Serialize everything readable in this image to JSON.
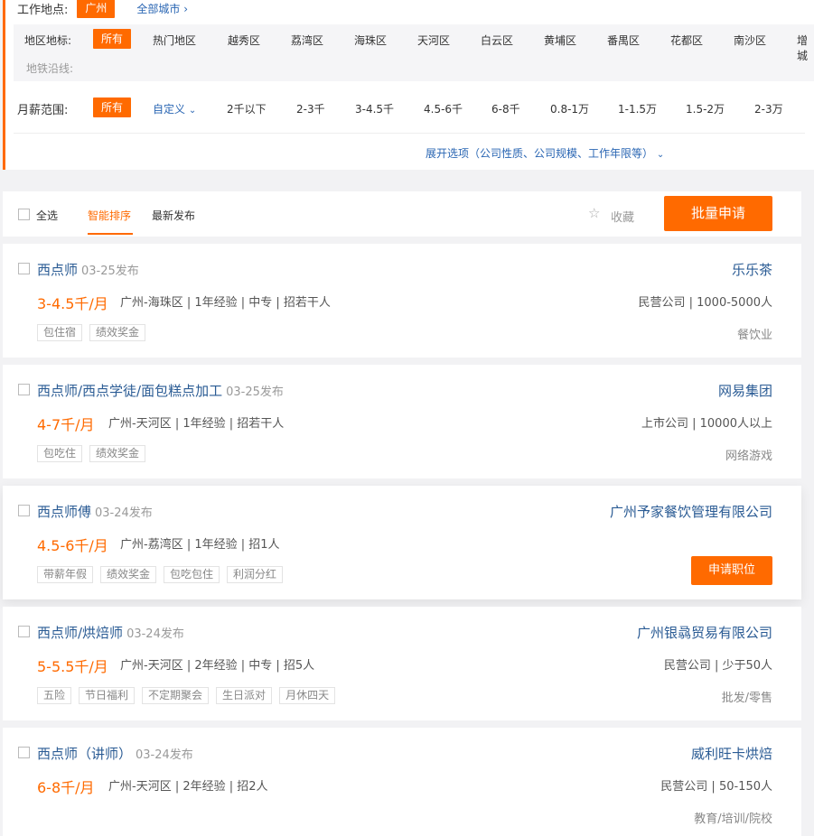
{
  "filters": {
    "location_label": "工作地点:",
    "location_active": "广州",
    "all_cities": "全部城市",
    "district_label": "地区地标:",
    "district_active": "所有",
    "districts": [
      "热门地区",
      "越秀区",
      "荔湾区",
      "海珠区",
      "天河区",
      "白云区",
      "黄埔区",
      "番禺区",
      "花都区",
      "南沙区",
      "增城"
    ],
    "metro_label": "地铁沿线:",
    "salary_label": "月薪范围:",
    "salary_active": "所有",
    "salary_custom": "自定义",
    "salaries": [
      "2千以下",
      "2-3千",
      "3-4.5千",
      "4.5-6千",
      "6-8千",
      "0.8-1万",
      "1-1.5万",
      "1.5-2万",
      "2-3万"
    ],
    "expand": "展开选项（公司性质、公司规模、工作年限等）"
  },
  "sortbar": {
    "select_all": "全选",
    "smart_sort": "智能排序",
    "latest": "最新发布",
    "favorite": "收藏",
    "batch_apply": "批量申请"
  },
  "jobs": [
    {
      "title": "西点师",
      "date": "03-25发布",
      "salary": "3-4.5千/月",
      "meta": "广州-海珠区 | 1年经验 | 中专 | 招若干人",
      "tags": [
        "包住宿",
        "绩效奖金"
      ],
      "company": "乐乐茶",
      "cinfo": "民营公司 | 1000-5000人",
      "industry": "餐饮业"
    },
    {
      "title": "西点师/西点学徒/面包糕点加工",
      "date": "03-25发布",
      "salary": "4-7千/月",
      "meta": "广州-天河区 | 1年经验 | 招若干人",
      "tags": [
        "包吃住",
        "绩效奖金"
      ],
      "company": "网易集团",
      "cinfo": "上市公司 | 10000人以上",
      "industry": "网络游戏"
    },
    {
      "title": "西点师傅",
      "date": "03-24发布",
      "salary": "4.5-6千/月",
      "meta": "广州-荔湾区 | 1年经验 | 招1人",
      "tags": [
        "带薪年假",
        "绩效奖金",
        "包吃包住",
        "利润分红"
      ],
      "company": "广州予家餐饮管理有限公司",
      "apply": "申请职位"
    },
    {
      "title": "西点师/烘焙师",
      "date": "03-24发布",
      "salary": "5-5.5千/月",
      "meta": "广州-天河区 | 2年经验 | 中专 | 招5人",
      "tags": [
        "五险",
        "节日福利",
        "不定期聚会",
        "生日派对",
        "月休四天"
      ],
      "company": "广州银骉贸易有限公司",
      "cinfo": "民营公司 | 少于50人",
      "industry": "批发/零售"
    },
    {
      "title": "西点师（讲师）",
      "date": "03-24发布",
      "salary": "6-8千/月",
      "meta": "广州-天河区 | 2年经验 | 招2人",
      "tags": [],
      "company": "威利旺卡烘焙",
      "cinfo": "民营公司 | 50-150人",
      "industry": "教育/培训/院校"
    }
  ]
}
